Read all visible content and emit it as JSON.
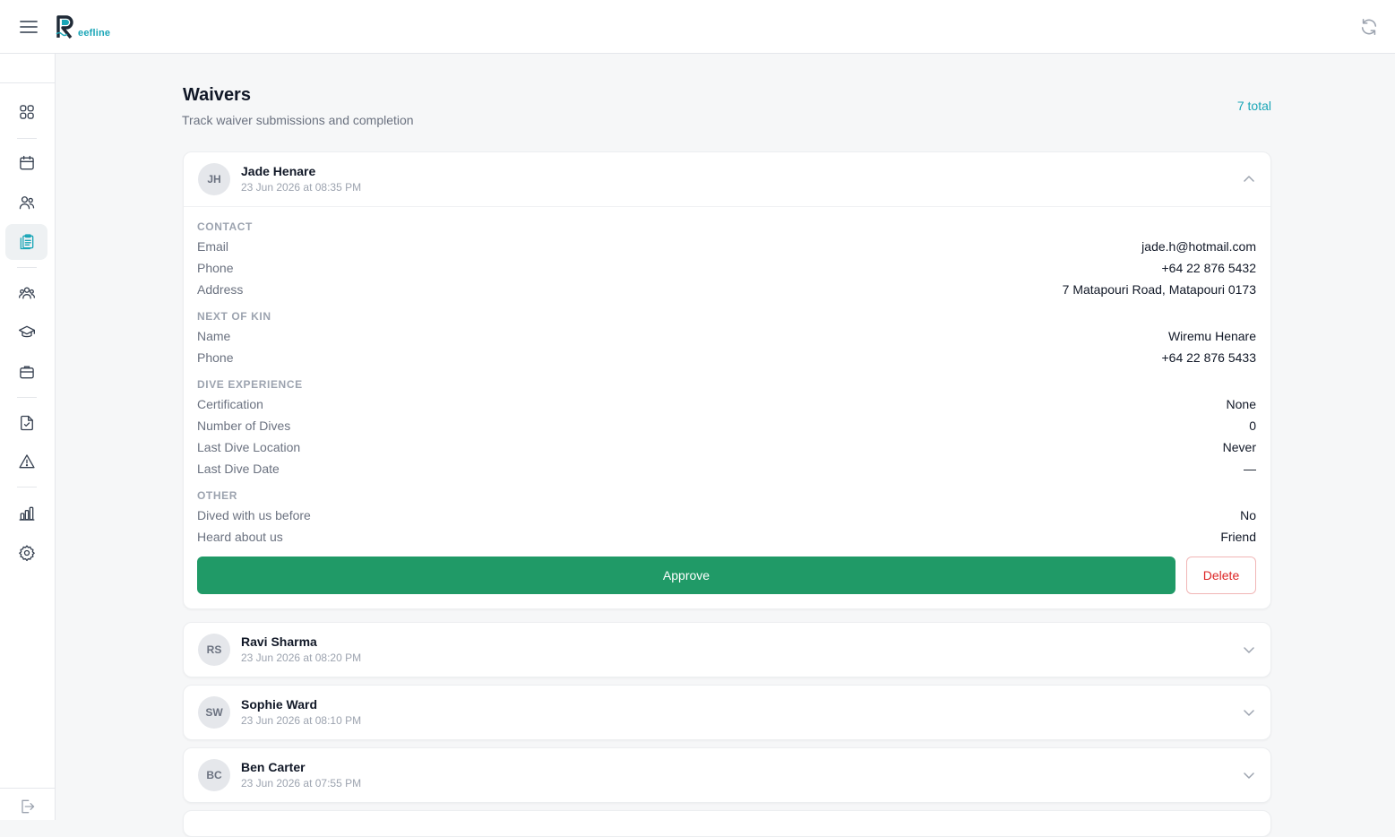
{
  "app": {
    "logo_initial": "R",
    "logo_text": "eefline"
  },
  "sidebar": {
    "items": [
      {
        "icon": "dashboard-grid-icon"
      },
      {
        "icon": "calendar-icon"
      },
      {
        "icon": "users-icon"
      },
      {
        "icon": "clipboard-icon",
        "active": true
      },
      {
        "icon": "team-icon"
      },
      {
        "icon": "graduation-cap-icon"
      },
      {
        "icon": "briefcase-icon"
      },
      {
        "icon": "file-check-icon"
      },
      {
        "icon": "warning-triangle-icon"
      },
      {
        "icon": "bar-chart-icon"
      },
      {
        "icon": "settings-gear-icon"
      }
    ],
    "bottom_icon": "logout-icon"
  },
  "page": {
    "title": "Waivers",
    "subtitle": "Track waiver submissions and completion",
    "total": "7 total"
  },
  "expanded": {
    "initials": "JH",
    "name": "Jade Henare",
    "date": "23 Jun 2026 at 08:35 PM",
    "contact_title": "CONTACT",
    "email_label": "Email",
    "email": "jade.h@hotmail.com",
    "phone_label": "Phone",
    "phone": "+64 22 876 5432",
    "address_label": "Address",
    "address": "7 Matapouri Road, Matapouri 0173",
    "kin_title": "NEXT OF KIN",
    "kin_name_label": "Name",
    "kin_name": "Wiremu Henare",
    "kin_phone_label": "Phone",
    "kin_phone": "+64 22 876 5433",
    "dive_title": "DIVE EXPERIENCE",
    "cert_label": "Certification",
    "cert": "None",
    "num_dives_label": "Number of Dives",
    "num_dives": "0",
    "last_loc_label": "Last Dive Location",
    "last_loc": "Never",
    "last_date_label": "Last Dive Date",
    "last_date": "—",
    "other_title": "OTHER",
    "dived_before_label": "Dived with us before",
    "dived_before": "No",
    "heard_label": "Heard about us",
    "heard": "Friend",
    "approve_label": "Approve",
    "delete_label": "Delete"
  },
  "waivers": [
    {
      "initials": "RS",
      "name": "Ravi Sharma",
      "date": "23 Jun 2026 at 08:20 PM"
    },
    {
      "initials": "SW",
      "name": "Sophie Ward",
      "date": "23 Jun 2026 at 08:10 PM"
    },
    {
      "initials": "BC",
      "name": "Ben Carter",
      "date": "23 Jun 2026 at 07:55 PM"
    }
  ]
}
